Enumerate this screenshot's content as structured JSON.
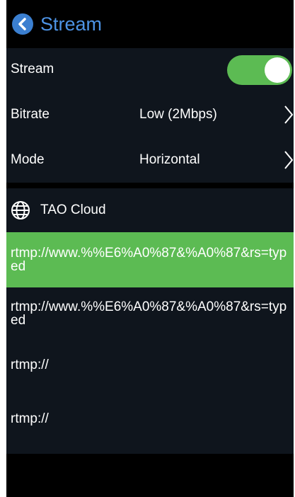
{
  "header": {
    "title": "Stream"
  },
  "settings": {
    "stream": {
      "label": "Stream",
      "enabled": true
    },
    "bitrate": {
      "label": "Bitrate",
      "value": "Low (2Mbps)"
    },
    "mode": {
      "label": "Mode",
      "value": "Horizontal"
    }
  },
  "cloud": {
    "title": "TAO Cloud",
    "urls": [
      {
        "text": "rtmp://www.%%E6%A0%87&%A0%87&rs=typed",
        "selected": true
      },
      {
        "text": "rtmp://www.%%E6%A0%87&%A0%87&rs=typed",
        "selected": false
      },
      {
        "text": "rtmp://",
        "selected": false
      },
      {
        "text": "rtmp://",
        "selected": false
      }
    ]
  },
  "colors": {
    "accent": "#4d93e5",
    "toggle_on": "#5cbb53",
    "selected_row": "#5cbb53",
    "panel": "#0f151d",
    "background": "#000000"
  },
  "icons": {
    "back": "chevron-left-icon",
    "globe": "globe-icon",
    "chevron": "chevron-right-icon"
  }
}
